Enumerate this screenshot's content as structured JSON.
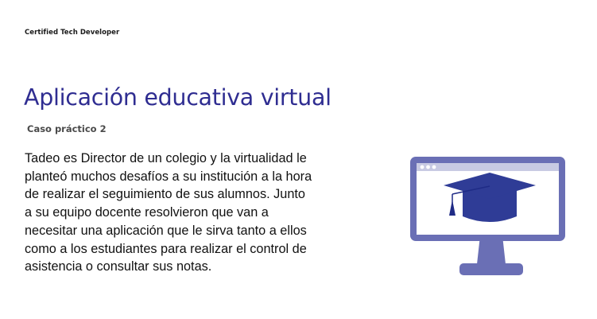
{
  "header": {
    "label": "Certified Tech Developer"
  },
  "slide": {
    "title": "Aplicación educativa virtual",
    "subtitle": "Caso práctico 2",
    "body": "Tadeo es Director de un colegio y la virtualidad le planteó muchos desafíos a su institución a la hora de realizar el seguimiento de sus alumnos. Junto a su equipo docente resolvieron que van a necesitar una aplicación que le sirva tanto a ellos como a los estudiantes para realizar el control de asistencia o consultar sus notas."
  },
  "illustration": {
    "icon": "monitor-graduation-cap-icon",
    "colors": {
      "monitor_frame": "#6a6fb5",
      "screen": "#ffffff",
      "title_bar": "#c8cae3",
      "cap": "#2f3c96",
      "tassel": "#1f2b86"
    }
  }
}
